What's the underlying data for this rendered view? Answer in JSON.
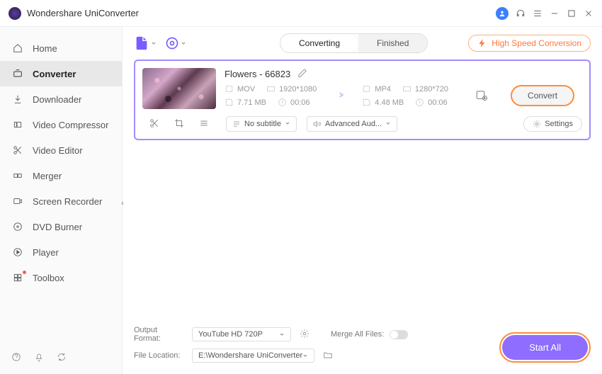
{
  "app_title": "Wondershare UniConverter",
  "sidebar": {
    "items": [
      {
        "label": "Home"
      },
      {
        "label": "Converter"
      },
      {
        "label": "Downloader"
      },
      {
        "label": "Video Compressor"
      },
      {
        "label": "Video Editor"
      },
      {
        "label": "Merger"
      },
      {
        "label": "Screen Recorder"
      },
      {
        "label": "DVD Burner"
      },
      {
        "label": "Player"
      },
      {
        "label": "Toolbox"
      }
    ]
  },
  "tabs": {
    "converting": "Converting",
    "finished": "Finished"
  },
  "hsc": "High Speed Conversion",
  "file": {
    "name": "Flowers - 66823",
    "src": {
      "format": "MOV",
      "res": "1920*1080",
      "size": "7.71 MB",
      "dur": "00:06"
    },
    "dst": {
      "format": "MP4",
      "res": "1280*720",
      "size": "4.48 MB",
      "dur": "00:06"
    },
    "convert_label": "Convert"
  },
  "row2": {
    "subtitle": "No subtitle",
    "audio": "Advanced Aud...",
    "settings": "Settings"
  },
  "bottom": {
    "output_label": "Output Format:",
    "output_value": "YouTube HD 720P",
    "location_label": "File Location:",
    "location_value": "E:\\Wondershare UniConverter",
    "merge_label": "Merge All Files:",
    "start_all": "Start All"
  }
}
